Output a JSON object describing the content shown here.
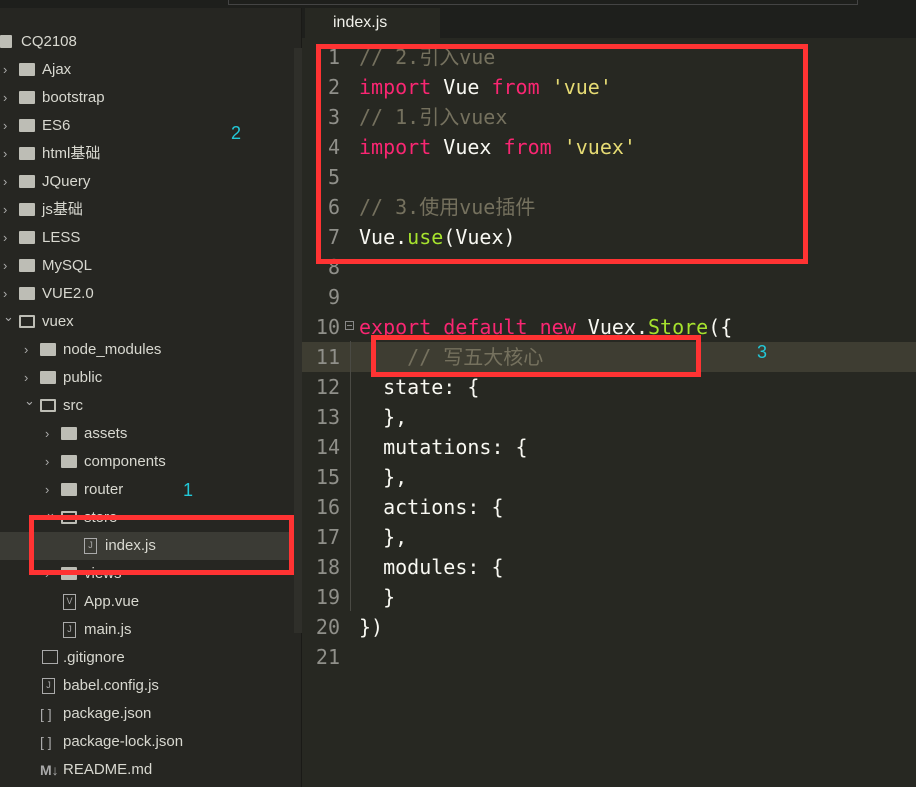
{
  "sidebar": {
    "items": [
      {
        "label": "CQ2108",
        "level": -1,
        "arrow": "none",
        "icon": "project"
      },
      {
        "label": "Ajax",
        "level": 0,
        "arrow": "right",
        "icon": "folder"
      },
      {
        "label": "bootstrap",
        "level": 0,
        "arrow": "right",
        "icon": "folder"
      },
      {
        "label": "ES6",
        "level": 0,
        "arrow": "right",
        "icon": "folder"
      },
      {
        "label": "html基础",
        "level": 0,
        "arrow": "right",
        "icon": "folder"
      },
      {
        "label": "JQuery",
        "level": 0,
        "arrow": "right",
        "icon": "folder"
      },
      {
        "label": "js基础",
        "level": 0,
        "arrow": "right",
        "icon": "folder"
      },
      {
        "label": "LESS",
        "level": 0,
        "arrow": "right",
        "icon": "folder"
      },
      {
        "label": "MySQL",
        "level": 0,
        "arrow": "right",
        "icon": "folder"
      },
      {
        "label": "VUE2.0",
        "level": 0,
        "arrow": "right",
        "icon": "folder"
      },
      {
        "label": "vuex",
        "level": 0,
        "arrow": "down",
        "icon": "folder-open"
      },
      {
        "label": "node_modules",
        "level": 1,
        "arrow": "right",
        "icon": "folder"
      },
      {
        "label": "public",
        "level": 1,
        "arrow": "right",
        "icon": "folder"
      },
      {
        "label": "src",
        "level": 1,
        "arrow": "down",
        "icon": "folder-open"
      },
      {
        "label": "assets",
        "level": 2,
        "arrow": "right",
        "icon": "folder"
      },
      {
        "label": "components",
        "level": 2,
        "arrow": "right",
        "icon": "folder"
      },
      {
        "label": "router",
        "level": 2,
        "arrow": "right",
        "icon": "folder"
      },
      {
        "label": "store",
        "level": 2,
        "arrow": "down",
        "icon": "folder-open"
      },
      {
        "label": "index.js",
        "level": 3,
        "arrow": "none",
        "icon": "js-file",
        "selected": true
      },
      {
        "label": "views",
        "level": 2,
        "arrow": "right",
        "icon": "folder"
      },
      {
        "label": "App.vue",
        "level": 2,
        "arrow": "none",
        "icon": "vue-file"
      },
      {
        "label": "main.js",
        "level": 2,
        "arrow": "none",
        "icon": "js-file"
      },
      {
        "label": ".gitignore",
        "level": 1,
        "arrow": "none",
        "icon": "file"
      },
      {
        "label": "babel.config.js",
        "level": 1,
        "arrow": "none",
        "icon": "js-file"
      },
      {
        "label": "package.json",
        "level": 1,
        "arrow": "none",
        "icon": "json-file"
      },
      {
        "label": "package-lock.json",
        "level": 1,
        "arrow": "none",
        "icon": "json-file"
      },
      {
        "label": "README.md",
        "level": 1,
        "arrow": "none",
        "icon": "markdown-file"
      }
    ]
  },
  "tab": {
    "label": "index.js"
  },
  "editor": {
    "highlight_line": 11,
    "lines": [
      [
        [
          "c",
          "// 2.引入vue"
        ]
      ],
      [
        [
          "k",
          "import"
        ],
        [
          "d",
          " Vue "
        ],
        [
          "k",
          "from"
        ],
        [
          "d",
          " "
        ],
        [
          "s",
          "'vue'"
        ]
      ],
      [
        [
          "c",
          "// 1.引入vuex"
        ]
      ],
      [
        [
          "k",
          "import"
        ],
        [
          "d",
          " Vuex "
        ],
        [
          "k",
          "from"
        ],
        [
          "d",
          " "
        ],
        [
          "s",
          "'vuex'"
        ]
      ],
      [],
      [
        [
          "c",
          "// 3.使用vue插件"
        ]
      ],
      [
        [
          "d",
          "Vue."
        ],
        [
          "f",
          "use"
        ],
        [
          "d",
          "(Vuex)"
        ]
      ],
      [],
      [],
      [
        [
          "k",
          "export"
        ],
        [
          "d",
          " "
        ],
        [
          "k",
          "default"
        ],
        [
          "d",
          " "
        ],
        [
          "k",
          "new"
        ],
        [
          "d",
          " Vuex."
        ],
        [
          "f",
          "Store"
        ],
        [
          "d",
          "({"
        ]
      ],
      [
        [
          "c",
          "    // 写五大核心"
        ]
      ],
      [
        [
          "d",
          "  state: {"
        ]
      ],
      [
        [
          "d",
          "  },"
        ]
      ],
      [
        [
          "d",
          "  mutations: {"
        ]
      ],
      [
        [
          "d",
          "  },"
        ]
      ],
      [
        [
          "d",
          "  actions: {"
        ]
      ],
      [
        [
          "d",
          "  },"
        ]
      ],
      [
        [
          "d",
          "  modules: {"
        ]
      ],
      [
        [
          "d",
          "  }"
        ]
      ],
      [
        [
          "d",
          "})"
        ]
      ],
      []
    ]
  },
  "annotations": {
    "one": "1",
    "two": "2",
    "three": "3"
  },
  "colors": {
    "annotation_box": "#ff3333",
    "annotation_text": "#22c8d8",
    "keyword": "#f92672",
    "string": "#e6db74",
    "comment": "#75715e",
    "function": "#a6e22e"
  }
}
